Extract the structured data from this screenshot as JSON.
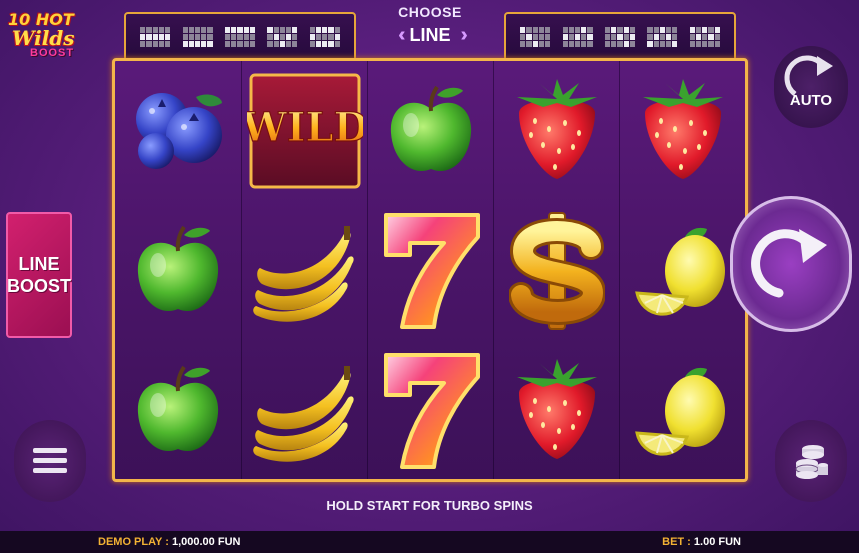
{
  "logo": {
    "line1": "10 HOT",
    "line2": "Wilds",
    "line3": "BOOST"
  },
  "choose": {
    "label_top": "CHOOSE",
    "label_bottom": "LINE"
  },
  "line_patterns_left": [
    "000001111100000",
    "000000000011111",
    "111110000000000",
    "100010101000100",
    "011101000101110"
  ],
  "line_patterns_right": [
    "100000100000100",
    "000101010100000",
    "010100010100010",
    "001000101010001",
    "101010101000000"
  ],
  "reels": [
    [
      "blueberry",
      "apple",
      "apple"
    ],
    [
      "wild",
      "banana",
      "banana"
    ],
    [
      "apple",
      "seven",
      "seven"
    ],
    [
      "strawberry",
      "dollar",
      "strawberry"
    ],
    [
      "strawberry",
      "lemon",
      "lemon"
    ]
  ],
  "wild_text": "WILD",
  "buttons": {
    "auto": "AUTO",
    "line_boost_1": "LINE",
    "line_boost_2": "BOOST"
  },
  "message": "HOLD START FOR TURBO SPINS",
  "footer": {
    "demo_label": "DEMO PLAY :",
    "demo_value": "1,000.00 FUN",
    "bet_label": "BET :",
    "bet_value": "1.00 FUN"
  },
  "icons": [
    "menu-icon",
    "coins-stack-icon",
    "spin-arrow-icon",
    "autoplay-arrow-icon"
  ]
}
